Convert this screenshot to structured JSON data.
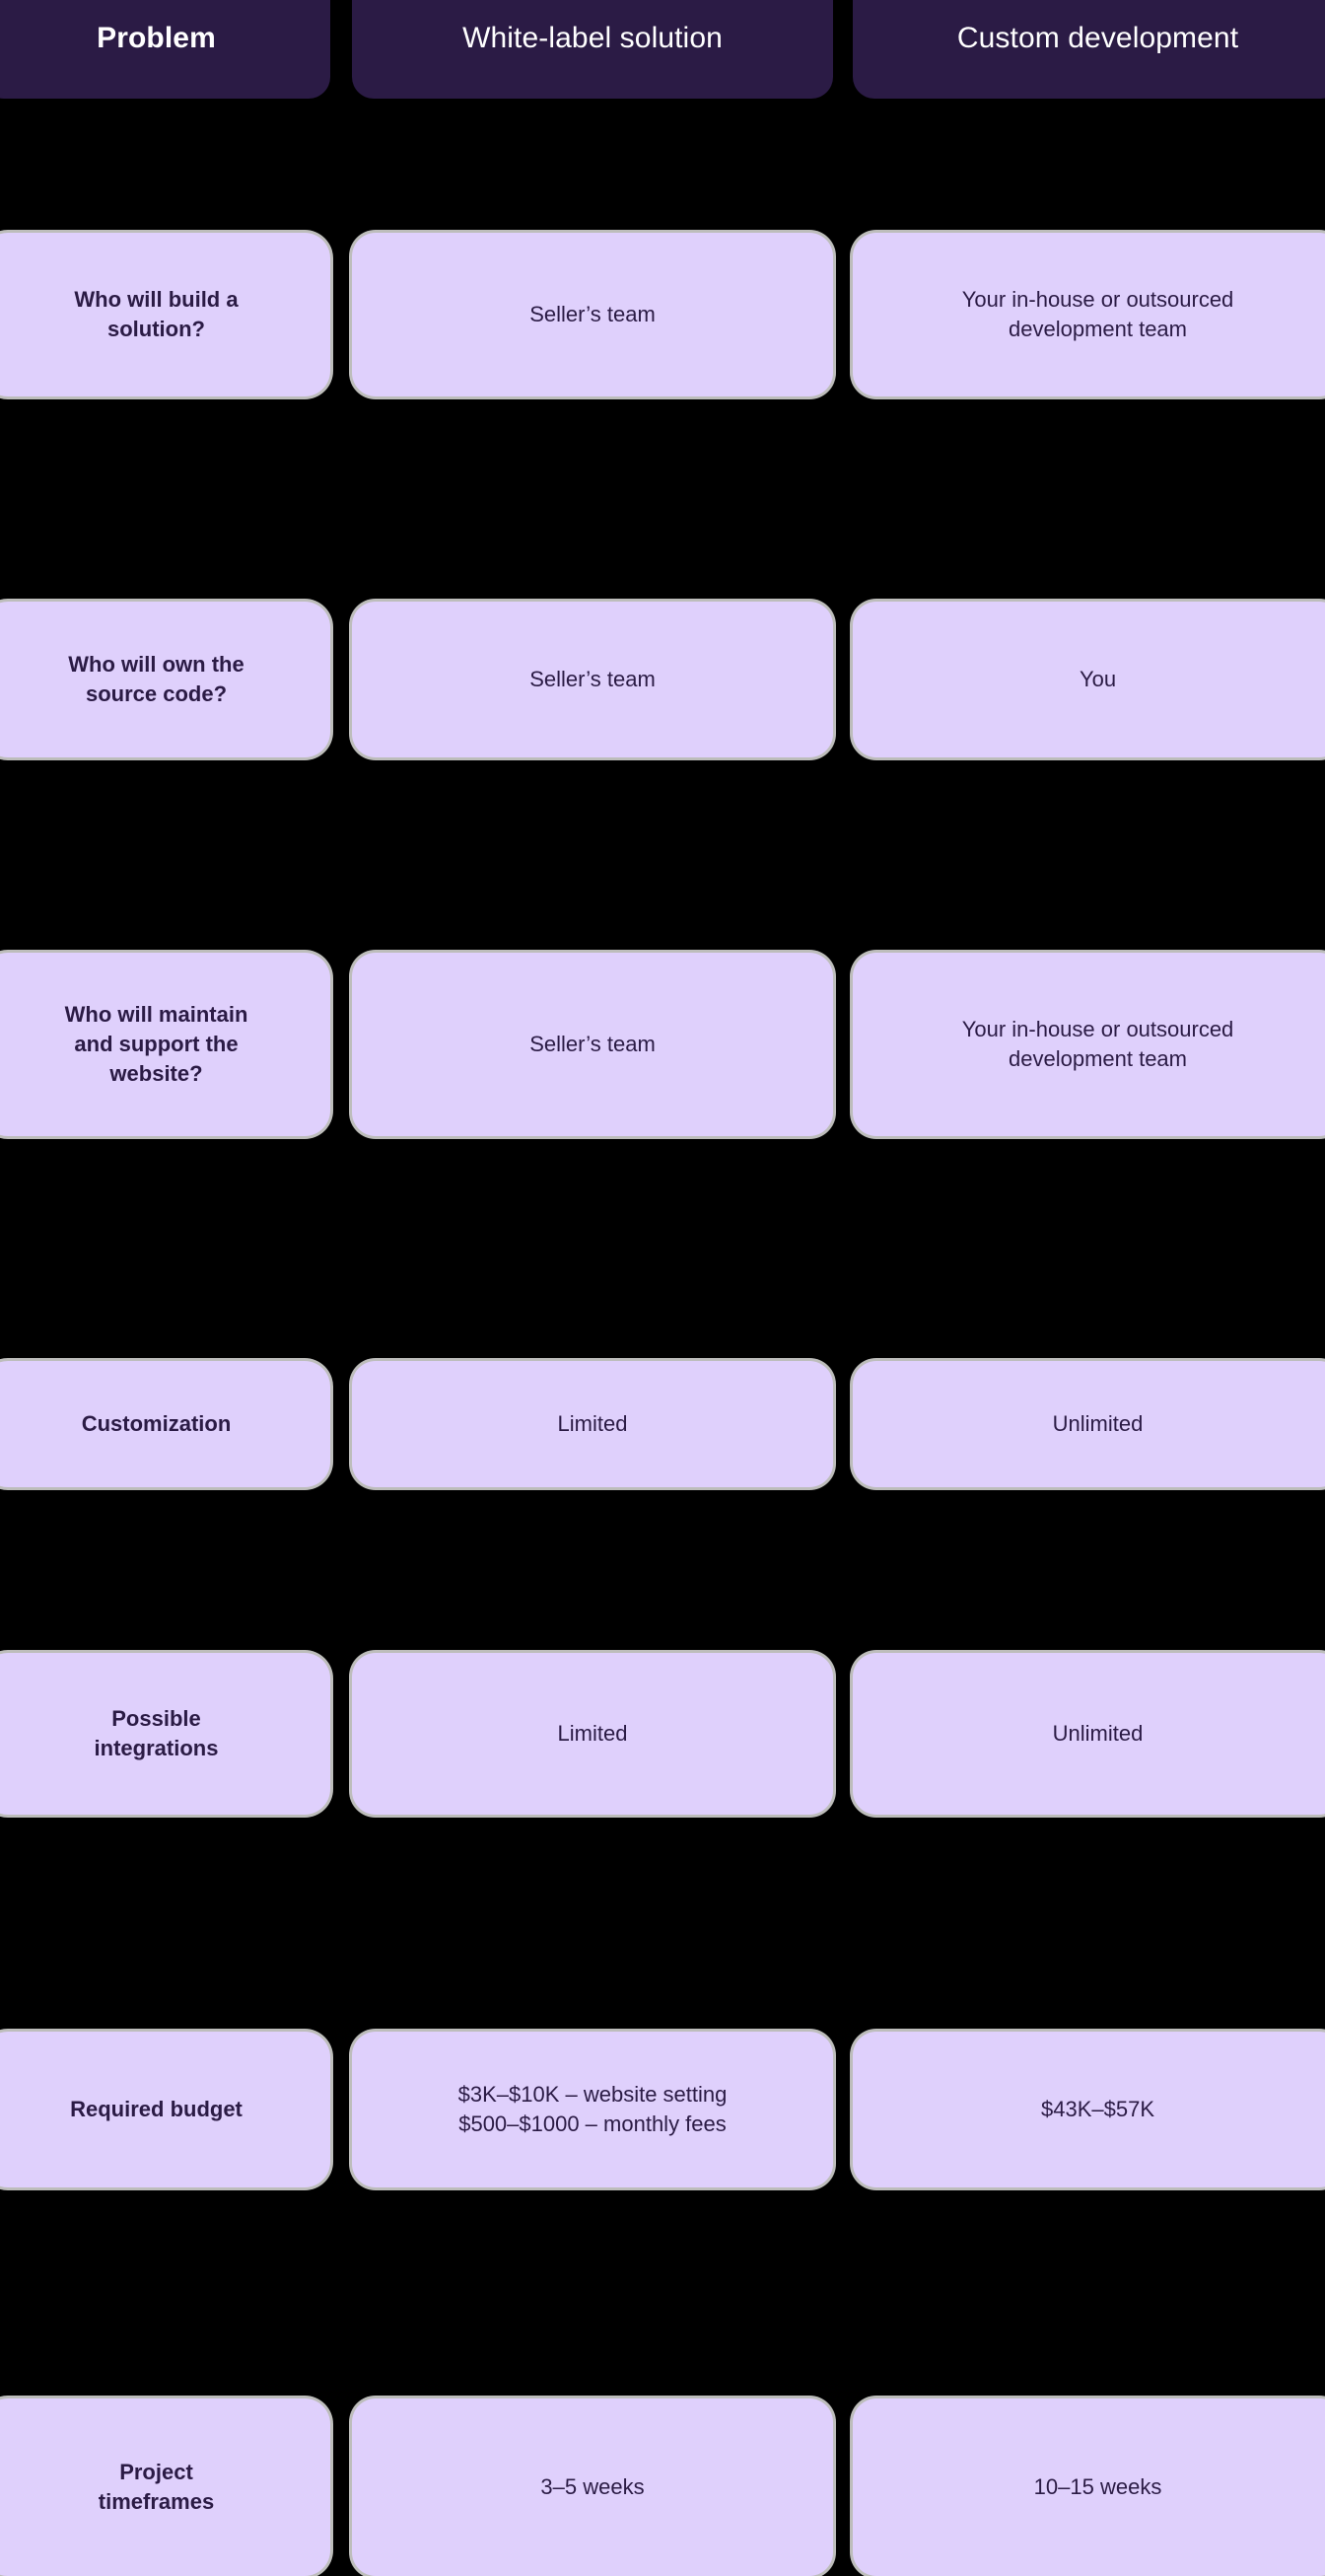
{
  "colors": {
    "background": "#000000",
    "header_card": "#2B1B45",
    "body_card": "#DFD0FC",
    "text_dark": "#2B1B45",
    "text_light": "#FFFFFF",
    "card_edge": "#DEDEDC"
  },
  "table": {
    "headers": [
      "Problem",
      "White-label solution",
      "Custom development"
    ],
    "rows": [
      {
        "problem": "Who will build a\nsolution?",
        "white_label": "Seller’s team",
        "custom": "Your in-house or outsourced\ndevelopment team"
      },
      {
        "problem": "Who will own the\nsource code?",
        "white_label": "Seller’s team",
        "custom": "You"
      },
      {
        "problem": "Who will maintain\nand support the\nwebsite?",
        "white_label": "Seller’s team",
        "custom": "Your in-house or outsourced\ndevelopment team"
      },
      {
        "problem": "Customization",
        "white_label": "Limited",
        "custom": "Unlimited"
      },
      {
        "problem": "Possible\nintegrations",
        "white_label": "Limited",
        "custom": "Unlimited"
      },
      {
        "problem": "Required budget",
        "white_label": "$3K–$10K – website setting\n$500–$1000 – monthly fees",
        "custom": "$43K–$57K"
      },
      {
        "problem": "Project\ntimeframes",
        "white_label": "3–5 weeks",
        "custom": "10–15 weeks"
      }
    ]
  }
}
